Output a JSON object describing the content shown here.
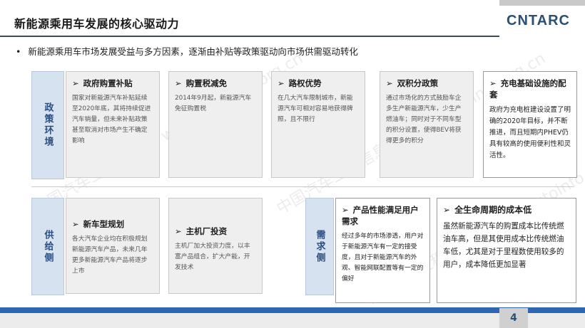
{
  "header": {
    "title": "新能源乘用车发展的核心驱动力",
    "logo_text": "CNTARC",
    "subtitle_bullet": "•",
    "subtitle": "新能源乘用车市场发展受益与多方因素，逐渐由补贴等政策驱动向市场供需驱动转化"
  },
  "sections": {
    "policy_label": "政策环境",
    "supply_label": "供给侧",
    "demand_label": "需求侧"
  },
  "policy_cards": [
    {
      "arrow": "➢",
      "title": "政府购置补贴",
      "body": "国家对新能源汽车补贴延续至2020年底，其将持续促进汽车销量，但未来补贴政策甚至取消对市场产生不确定影响"
    },
    {
      "arrow": "➢",
      "title": "购置税减免",
      "body": "2014年9月起，新能源汽车免征购置税"
    },
    {
      "arrow": "➢",
      "title": "路权优势",
      "body": "在几大汽车限制城市，新能源汽车可相对容易地获得牌照，且不限行"
    },
    {
      "arrow": "➢",
      "title": "双积分政策",
      "body": "通过市场化的方式鼓励车企多生产新能源汽车，少生产燃油车；同时对于不同车型的积分设置，使得BEV将获得更多的积分"
    },
    {
      "arrow": "➢",
      "title": "充电基础设施的配套",
      "body": "政府为充电桩建设设置了明确的2020年目标，并不断推进，而且短期内PHEV仍具有较高的使用便利性和灵活性。"
    }
  ],
  "supply_cards": [
    {
      "arrow": "➢",
      "title": "新车型规划",
      "body": "各大汽车企业均在积极规划新能源汽车产品，未来几年更多新能源汽车产品将逐步上市"
    },
    {
      "arrow": "➢",
      "title": "主机厂投资",
      "body": "主机厂加大投资力度，以丰富产品组合，扩大产能，开发技术"
    }
  ],
  "demand_cards": [
    {
      "arrow": "➢",
      "title": "产品性能满足用户需求",
      "body": "经过多年的市场渗透，用户对于新能源汽车有一定的接受度，且对于新能源汽车的外观、智能网联配置等有一定的偏好"
    },
    {
      "arrow": "➢",
      "title": "全生命周期的成本低",
      "body": "虽然新能源汽车的购置成本比传统燃油车高，但是其使用成本比传统燃油车低，尤其是对于里程数使用较多的用户，成本降低更加显著"
    }
  ],
  "footer": {
    "page": "4"
  },
  "watermark": "中国汽车工程信息网 www.autoinfo.org.cn",
  "colors": {
    "accent_blue": "#2d67b0",
    "section_fill": "#d6e2f0",
    "section_text": "#2a4e80"
  }
}
